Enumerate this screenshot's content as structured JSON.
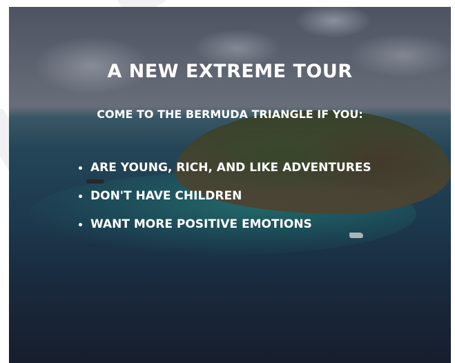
{
  "poster": {
    "title": "A NEW EXTREME TOUR",
    "subtitle": "COME TO THE BERMUDA TRIANGLE IF YOU:",
    "bullets": [
      "ARE YOUNG, RICH, AND LIKE ADVENTURES",
      "DON'T HAVE CHILDREN",
      "WANT MORE POSITIVE EMOTIONS"
    ]
  },
  "colors": {
    "text": "#ffffff",
    "sea": "#1f3f55",
    "sky": "#6a6f7c"
  }
}
